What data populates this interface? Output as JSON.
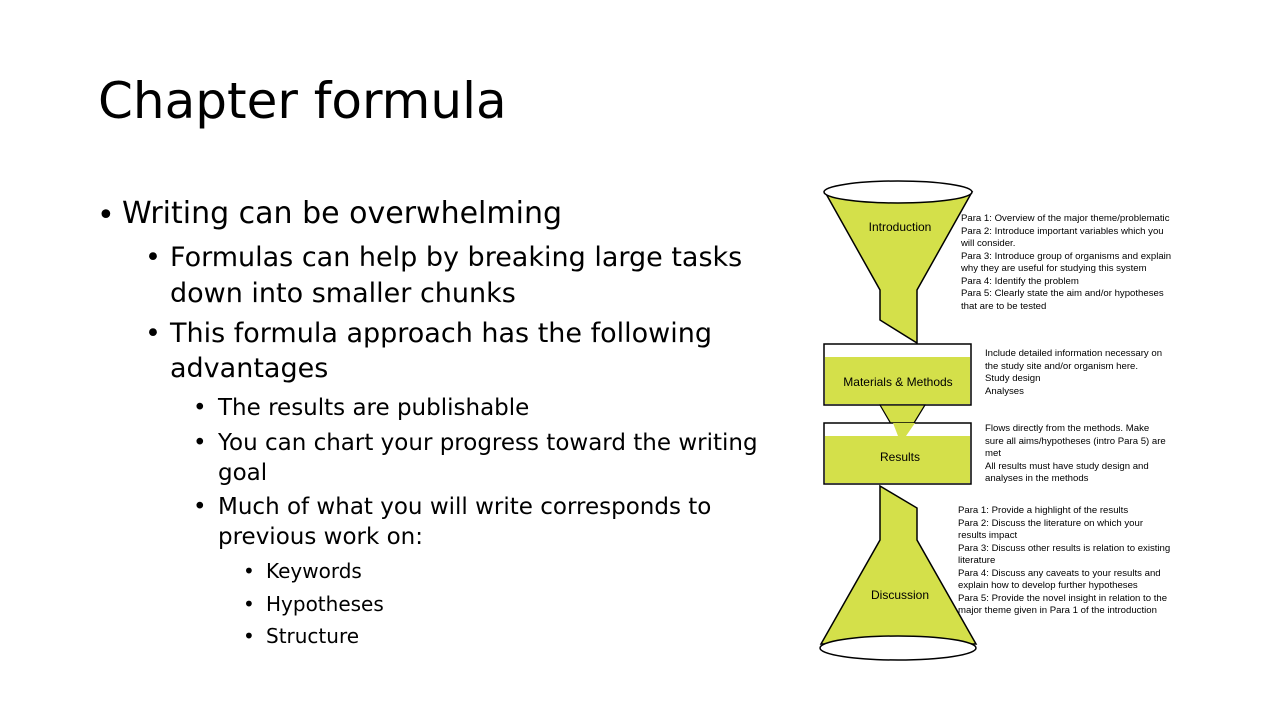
{
  "slide": {
    "title": "Chapter formula",
    "bullets": {
      "b1": "Writing can be overwhelming",
      "b2": "Formulas can help by breaking large tasks",
      "b2b": "down into smaller chunks",
      "b3": "This formula approach has the following",
      "b3b": "advantages",
      "b4": "The results are publishable",
      "b5": "You can chart your progress toward the writing",
      "b5b": "goal",
      "b6": "Much of what you will write corresponds to",
      "b6b": "previous work on:",
      "b7": "Keywords",
      "b8": "Hypotheses",
      "b9": "Structure"
    }
  },
  "diagram": {
    "fill_color": "#d4e04a",
    "stages": {
      "intro": "Introduction",
      "methods": "Materials & Methods",
      "results": "Results",
      "discussion": "Discussion"
    },
    "notes": {
      "intro": [
        "Para 1: Overview of the major theme/problematic",
        "Para 2: Introduce important variables which you",
        "will consider.",
        "Para 3: Introduce group of organisms and explain",
        "why they are useful for studying this system",
        "Para 4: Identify the problem",
        "Para 5: Clearly state the aim and/or hypotheses",
        "that are to be tested"
      ],
      "methods": [
        "Include detailed information necessary on",
        "the study site and/or organism here.",
        "Study design",
        "Analyses"
      ],
      "results": [
        "Flows directly from the methods. Make",
        "sure all aims/hypotheses (intro Para 5) are",
        "met",
        "All results must have study design and",
        "analyses in the methods"
      ],
      "discussion": [
        "Para 1: Provide a highlight of the results",
        "Para 2: Discuss the literature on which your",
        "results impact",
        "Para 3: Discuss other results is relation to existing",
        "literature",
        "Para 4: Discuss any caveats to your results and",
        "explain how to develop further hypotheses",
        "Para 5: Provide the novel insight in relation to the",
        "major theme given in Para 1 of the introduction"
      ]
    }
  }
}
